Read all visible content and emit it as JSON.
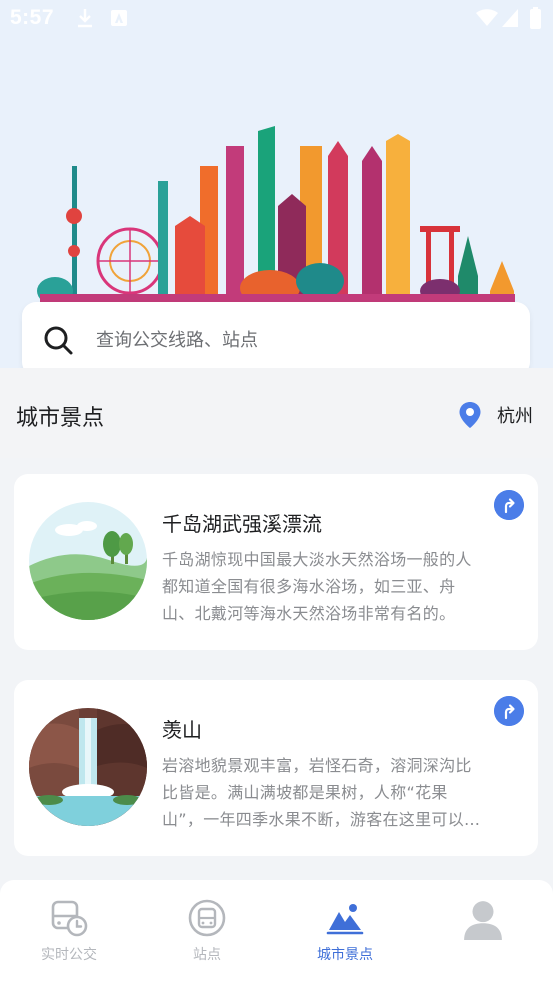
{
  "status_bar": {
    "time": "5:57"
  },
  "search": {
    "placeholder": "查询公交线路、站点"
  },
  "section": {
    "title": "城市景点",
    "city": "杭州"
  },
  "attractions": [
    {
      "title": "千岛湖武强溪漂流",
      "description": "千岛湖惊现中国最大淡水天然浴场一般的人都知道全国有很多海水浴场，如三亚、舟山、北戴河等海水天然浴场非常有名的。"
    },
    {
      "title": "羡山",
      "description": "岩溶地貌景观丰富，岩怪石奇，溶洞深沟比比皆是。满山满坡都是果树，人称“花果山”，一年四季水果不断，游客在这里可以尽情采摘。"
    }
  ],
  "tabs": [
    {
      "label": "实时公交",
      "icon": "bus-clock-icon",
      "active": false
    },
    {
      "label": "站点",
      "icon": "bus-stop-icon",
      "active": false
    },
    {
      "label": "城市景点",
      "icon": "mountain-icon",
      "active": true
    },
    {
      "label": "",
      "icon": "user-avatar-icon",
      "active": false
    }
  ],
  "colors": {
    "accent": "#3f6fd8",
    "nav_button": "#4b7de8",
    "background": "#f2f4f7",
    "hero_bg": "#e9f1fb"
  }
}
